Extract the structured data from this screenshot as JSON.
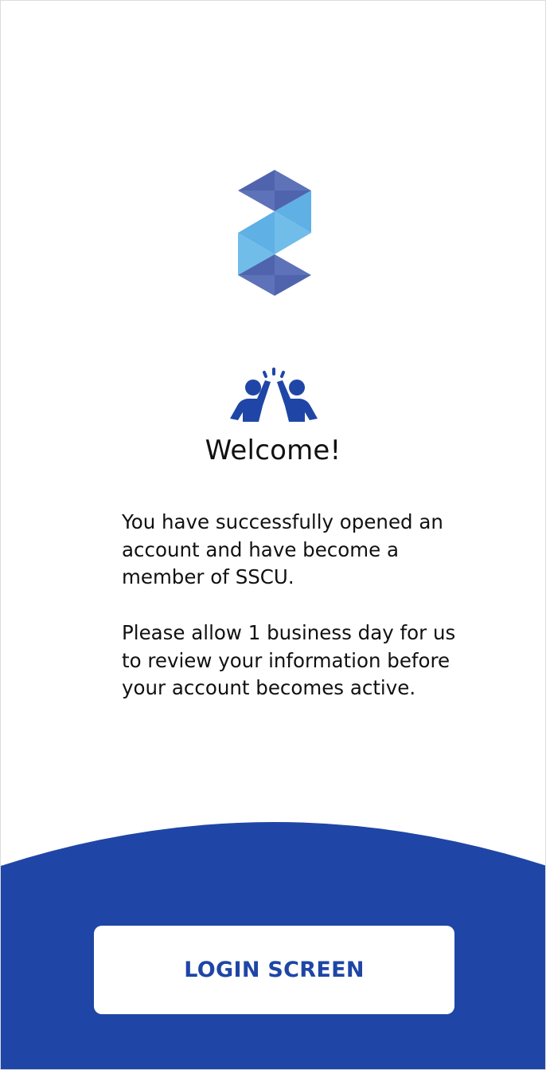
{
  "welcome": {
    "title": "Welcome!",
    "message_1": "You have successfully opened an account and have become a member of SSCU.",
    "message_2": "Please allow 1 business day for us to review your information before your account becomes active."
  },
  "actions": {
    "login_label": "LOGIN SCREEN"
  },
  "icons": {
    "logo": "brand-logo",
    "illustration": "high-five-icon"
  },
  "colors": {
    "brand_blue": "#1f46a6",
    "logo_dark": "#5369b1",
    "logo_light": "#6bb6e6",
    "text": "#111111",
    "background": "#ffffff"
  }
}
